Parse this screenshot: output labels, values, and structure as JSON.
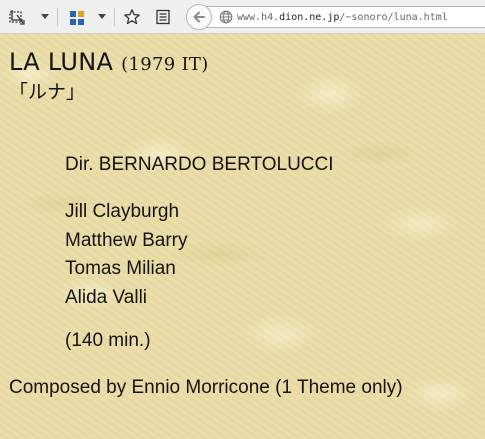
{
  "browser": {
    "toolbar": {
      "icons": [
        "screenshot-tool-icon",
        "dropdown-icon",
        "apps-grid-icon",
        "dropdown-icon",
        "star-icon",
        "reading-list-icon"
      ],
      "back_icon": "back-arrow-icon",
      "site_icon": "globe-icon"
    },
    "address": {
      "prefix": "www.h4.",
      "host": "dion.ne.jp",
      "path": "/~sonoro/luna.html"
    }
  },
  "page": {
    "title": "LA LUNA",
    "title_year": "(1979 IT)",
    "japanese_title": "「ルナ」",
    "director": "Dir. BERNARDO BERTOLUCCI",
    "cast": [
      "Jill Clayburgh",
      "Matthew Barry",
      "Tomas Milian",
      "Alida Valli"
    ],
    "runtime": "(140 min.)",
    "composer": "Composed by Ennio Morricone (1 Theme only)"
  },
  "colors": {
    "background": "#e9dca6",
    "text": "#141414",
    "toolbar": "#f0f0f0"
  }
}
